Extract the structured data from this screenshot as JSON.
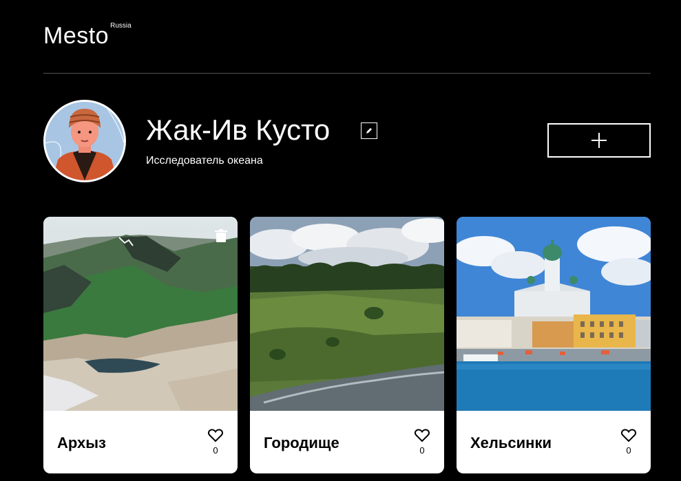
{
  "header": {
    "logo_text": "Mesto",
    "logo_superscript": "Russia"
  },
  "profile": {
    "name": "Жак-Ив Кусто",
    "about": "Исследователь океана",
    "edit_icon": "pencil-icon",
    "add_icon": "plus-icon"
  },
  "cards": [
    {
      "title": "Архыз",
      "likes": "0",
      "deletable": true
    },
    {
      "title": "Городище",
      "likes": "0",
      "deletable": false
    },
    {
      "title": "Хельсинки",
      "likes": "0",
      "deletable": false
    }
  ],
  "colors": {
    "background": "#000000",
    "card": "#ffffff",
    "divider": "#545454"
  }
}
